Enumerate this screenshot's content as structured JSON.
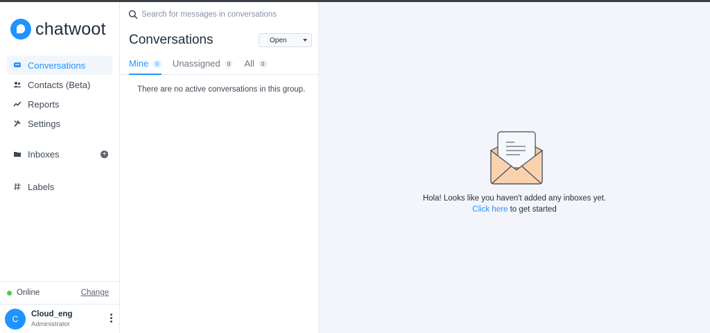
{
  "brand": {
    "name": "chatwoot"
  },
  "sidebar": {
    "items": [
      {
        "label": "Conversations",
        "icon": "chat-icon",
        "active": true
      },
      {
        "label": "Contacts (Beta)",
        "icon": "contacts-icon",
        "active": false
      },
      {
        "label": "Reports",
        "icon": "reports-icon",
        "active": false
      },
      {
        "label": "Settings",
        "icon": "settings-icon",
        "active": false
      }
    ],
    "inboxes_label": "Inboxes",
    "labels_label": "Labels",
    "status": {
      "text": "Online",
      "change_label": "Change"
    },
    "profile": {
      "initial": "C",
      "name": "Cloud_eng",
      "role": "Administrator"
    }
  },
  "conversations": {
    "search_placeholder": "Search for messages in conversations",
    "title": "Conversations",
    "status_filter": "Open",
    "tabs": [
      {
        "label": "Mine",
        "count": "0",
        "active": true
      },
      {
        "label": "Unassigned",
        "count": "0",
        "active": false
      },
      {
        "label": "All",
        "count": "0",
        "active": false
      }
    ],
    "empty_message": "There are no active conversations in this group."
  },
  "main": {
    "message": "Hola! Looks like you haven't added any inboxes yet.",
    "link_text": "Click here",
    "link_suffix": " to get started"
  },
  "colors": {
    "accent": "#1f93ff",
    "online": "#44ce4b",
    "background": "#f3f5fa"
  }
}
